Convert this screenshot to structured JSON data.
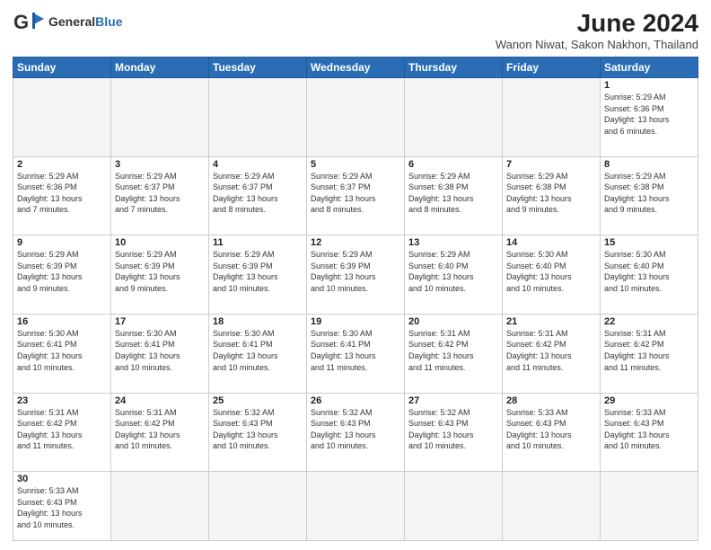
{
  "header": {
    "logo_general": "General",
    "logo_blue": "Blue",
    "month_year": "June 2024",
    "location": "Wanon Niwat, Sakon Nakhon, Thailand"
  },
  "weekdays": [
    "Sunday",
    "Monday",
    "Tuesday",
    "Wednesday",
    "Thursday",
    "Friday",
    "Saturday"
  ],
  "days": {
    "d1": {
      "num": "1",
      "info": "Sunrise: 5:29 AM\nSunset: 6:36 PM\nDaylight: 13 hours\nand 6 minutes."
    },
    "d2": {
      "num": "2",
      "info": "Sunrise: 5:29 AM\nSunset: 6:36 PM\nDaylight: 13 hours\nand 7 minutes."
    },
    "d3": {
      "num": "3",
      "info": "Sunrise: 5:29 AM\nSunset: 6:37 PM\nDaylight: 13 hours\nand 7 minutes."
    },
    "d4": {
      "num": "4",
      "info": "Sunrise: 5:29 AM\nSunset: 6:37 PM\nDaylight: 13 hours\nand 8 minutes."
    },
    "d5": {
      "num": "5",
      "info": "Sunrise: 5:29 AM\nSunset: 6:37 PM\nDaylight: 13 hours\nand 8 minutes."
    },
    "d6": {
      "num": "6",
      "info": "Sunrise: 5:29 AM\nSunset: 6:38 PM\nDaylight: 13 hours\nand 8 minutes."
    },
    "d7": {
      "num": "7",
      "info": "Sunrise: 5:29 AM\nSunset: 6:38 PM\nDaylight: 13 hours\nand 9 minutes."
    },
    "d8": {
      "num": "8",
      "info": "Sunrise: 5:29 AM\nSunset: 6:38 PM\nDaylight: 13 hours\nand 9 minutes."
    },
    "d9": {
      "num": "9",
      "info": "Sunrise: 5:29 AM\nSunset: 6:39 PM\nDaylight: 13 hours\nand 9 minutes."
    },
    "d10": {
      "num": "10",
      "info": "Sunrise: 5:29 AM\nSunset: 6:39 PM\nDaylight: 13 hours\nand 9 minutes."
    },
    "d11": {
      "num": "11",
      "info": "Sunrise: 5:29 AM\nSunset: 6:39 PM\nDaylight: 13 hours\nand 10 minutes."
    },
    "d12": {
      "num": "12",
      "info": "Sunrise: 5:29 AM\nSunset: 6:39 PM\nDaylight: 13 hours\nand 10 minutes."
    },
    "d13": {
      "num": "13",
      "info": "Sunrise: 5:29 AM\nSunset: 6:40 PM\nDaylight: 13 hours\nand 10 minutes."
    },
    "d14": {
      "num": "14",
      "info": "Sunrise: 5:30 AM\nSunset: 6:40 PM\nDaylight: 13 hours\nand 10 minutes."
    },
    "d15": {
      "num": "15",
      "info": "Sunrise: 5:30 AM\nSunset: 6:40 PM\nDaylight: 13 hours\nand 10 minutes."
    },
    "d16": {
      "num": "16",
      "info": "Sunrise: 5:30 AM\nSunset: 6:41 PM\nDaylight: 13 hours\nand 10 minutes."
    },
    "d17": {
      "num": "17",
      "info": "Sunrise: 5:30 AM\nSunset: 6:41 PM\nDaylight: 13 hours\nand 10 minutes."
    },
    "d18": {
      "num": "18",
      "info": "Sunrise: 5:30 AM\nSunset: 6:41 PM\nDaylight: 13 hours\nand 10 minutes."
    },
    "d19": {
      "num": "19",
      "info": "Sunrise: 5:30 AM\nSunset: 6:41 PM\nDaylight: 13 hours\nand 11 minutes."
    },
    "d20": {
      "num": "20",
      "info": "Sunrise: 5:31 AM\nSunset: 6:42 PM\nDaylight: 13 hours\nand 11 minutes."
    },
    "d21": {
      "num": "21",
      "info": "Sunrise: 5:31 AM\nSunset: 6:42 PM\nDaylight: 13 hours\nand 11 minutes."
    },
    "d22": {
      "num": "22",
      "info": "Sunrise: 5:31 AM\nSunset: 6:42 PM\nDaylight: 13 hours\nand 11 minutes."
    },
    "d23": {
      "num": "23",
      "info": "Sunrise: 5:31 AM\nSunset: 6:42 PM\nDaylight: 13 hours\nand 11 minutes."
    },
    "d24": {
      "num": "24",
      "info": "Sunrise: 5:31 AM\nSunset: 6:42 PM\nDaylight: 13 hours\nand 10 minutes."
    },
    "d25": {
      "num": "25",
      "info": "Sunrise: 5:32 AM\nSunset: 6:43 PM\nDaylight: 13 hours\nand 10 minutes."
    },
    "d26": {
      "num": "26",
      "info": "Sunrise: 5:32 AM\nSunset: 6:43 PM\nDaylight: 13 hours\nand 10 minutes."
    },
    "d27": {
      "num": "27",
      "info": "Sunrise: 5:32 AM\nSunset: 6:43 PM\nDaylight: 13 hours\nand 10 minutes."
    },
    "d28": {
      "num": "28",
      "info": "Sunrise: 5:33 AM\nSunset: 6:43 PM\nDaylight: 13 hours\nand 10 minutes."
    },
    "d29": {
      "num": "29",
      "info": "Sunrise: 5:33 AM\nSunset: 6:43 PM\nDaylight: 13 hours\nand 10 minutes."
    },
    "d30": {
      "num": "30",
      "info": "Sunrise: 5:33 AM\nSunset: 6:43 PM\nDaylight: 13 hours\nand 10 minutes."
    }
  }
}
